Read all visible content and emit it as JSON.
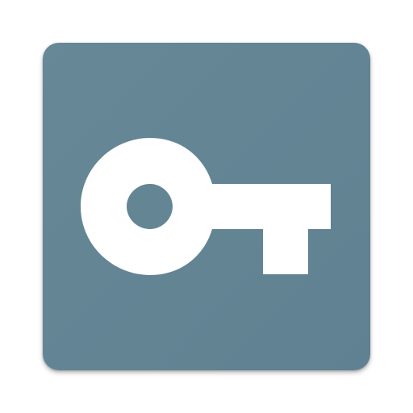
{
  "app_icon": {
    "icon": "key-icon",
    "background_color": "#5f8191",
    "background_color_light": "#678896",
    "glyph_color": "#ffffff"
  }
}
